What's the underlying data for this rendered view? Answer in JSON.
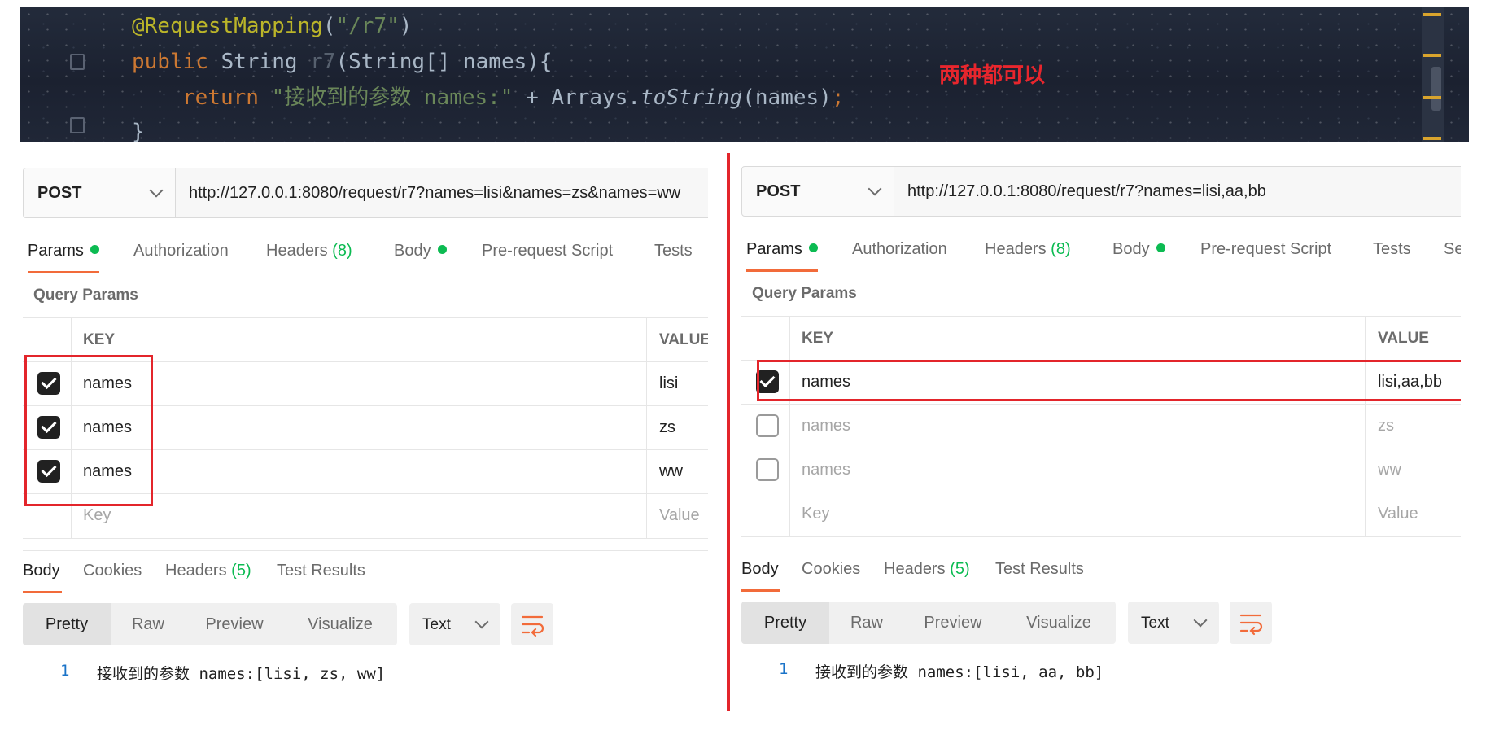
{
  "editor": {
    "line1": {
      "annotation": "@RequestMapping",
      "open": "(",
      "path": "\"/r7\"",
      "close": ")"
    },
    "line2": {
      "kw": "public",
      "type": " String ",
      "name": "r7",
      "params": "(String[] names){"
    },
    "line3": {
      "kw": "return",
      "str": " \"接收到的参数 names:\"",
      "plus": " + Arrays.",
      "method": "toString",
      "args": "(names)",
      "semi": ";"
    },
    "line4": {
      "text": "}"
    },
    "note": "两种都可以"
  },
  "left": {
    "method": "POST",
    "url": "http://127.0.0.1:8080/request/r7?names=lisi&names=zs&names=ww",
    "tabs": {
      "params": "Params",
      "authorization": "Authorization",
      "headers": "Headers",
      "headers_count": "(8)",
      "body": "Body",
      "prerequest": "Pre-request Script",
      "tests": "Tests"
    },
    "query_title": "Query Params",
    "columns": {
      "key": "KEY",
      "value": "VALUE"
    },
    "rows": [
      {
        "key": "names",
        "value": "lisi",
        "checked": true
      },
      {
        "key": "names",
        "value": "zs",
        "checked": true
      },
      {
        "key": "names",
        "value": "ww",
        "checked": true
      }
    ],
    "placeholder": {
      "key": "Key",
      "value": "Value"
    },
    "response_tabs": {
      "body": "Body",
      "cookies": "Cookies",
      "headers": "Headers",
      "headers_count": "(5)",
      "test_results": "Test Results"
    },
    "views": {
      "pretty": "Pretty",
      "raw": "Raw",
      "preview": "Preview",
      "visualize": "Visualize"
    },
    "format": "Text",
    "response": {
      "line_no": "1",
      "code": "接收到的参数 names:[lisi, zs, ww]"
    }
  },
  "right": {
    "method": "POST",
    "url": "http://127.0.0.1:8080/request/r7?names=lisi,aa,bb",
    "tabs": {
      "params": "Params",
      "authorization": "Authorization",
      "headers": "Headers",
      "headers_count": "(8)",
      "body": "Body",
      "prerequest": "Pre-request Script",
      "tests": "Tests",
      "more": "Se"
    },
    "query_title": "Query Params",
    "columns": {
      "key": "KEY",
      "value": "VALUE"
    },
    "rows": [
      {
        "key": "names",
        "value": "lisi,aa,bb",
        "checked": true
      },
      {
        "key": "names",
        "value": "zs",
        "checked": false
      },
      {
        "key": "names",
        "value": "ww",
        "checked": false
      }
    ],
    "placeholder": {
      "key": "Key",
      "value": "Value"
    },
    "response_tabs": {
      "body": "Body",
      "cookies": "Cookies",
      "headers": "Headers",
      "headers_count": "(5)",
      "test_results": "Test Results"
    },
    "views": {
      "pretty": "Pretty",
      "raw": "Raw",
      "preview": "Preview",
      "visualize": "Visualize"
    },
    "format": "Text",
    "response": {
      "line_no": "1",
      "code": "接收到的参数 names:[lisi, aa, bb]"
    }
  },
  "colors": {
    "accent_orange": "#f26b3a",
    "status_green": "#0cbb52",
    "highlight_red": "#e3252b",
    "editor_bg": "#1f2636"
  },
  "icons": [
    "chevron-down-icon",
    "check-icon",
    "wrap-lines-icon"
  ]
}
